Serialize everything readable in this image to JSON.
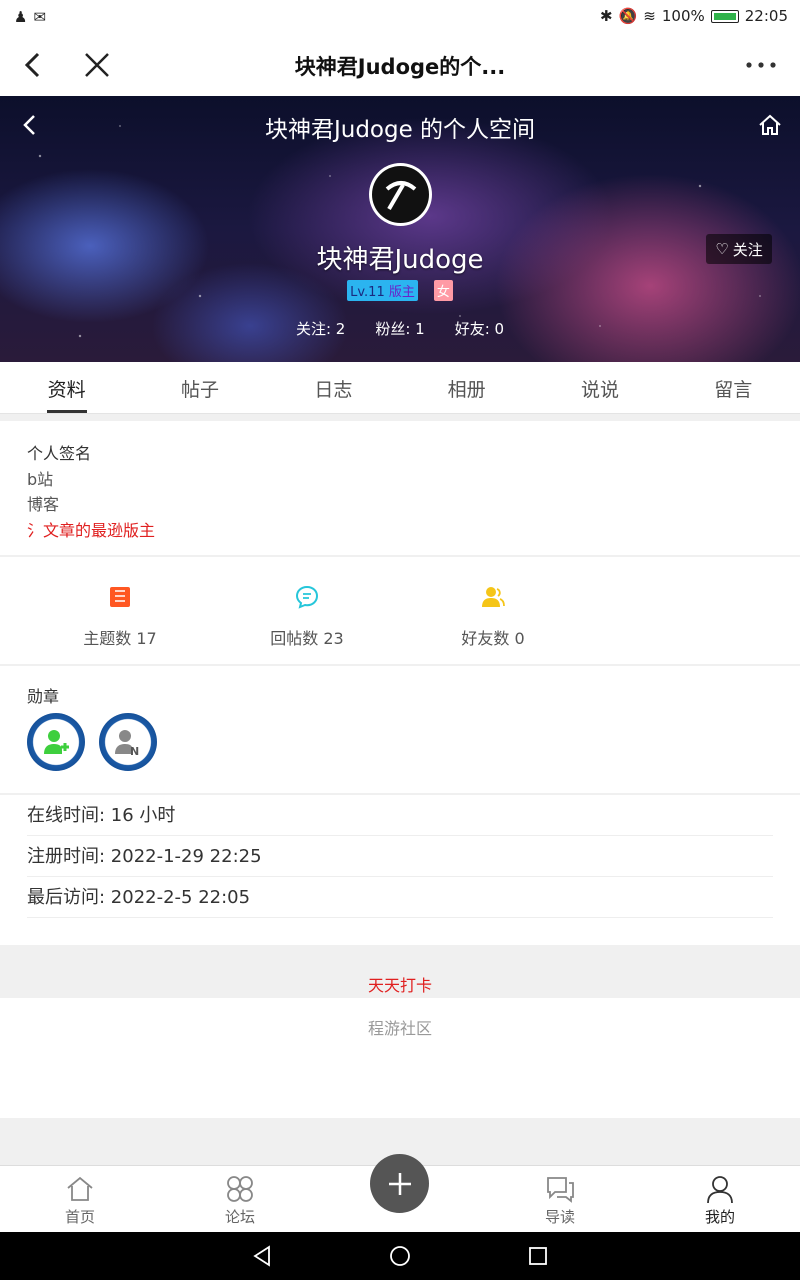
{
  "status_bar": {
    "battery": "100%",
    "time": "22:05"
  },
  "title_bar": {
    "title": "块神君Judoge的个..."
  },
  "hero": {
    "title": "块神君Judoge 的个人空间",
    "username": "块神君Judoge",
    "level": "Lv.11",
    "role": "版主",
    "gender": "女",
    "follow_label": "关注",
    "following": "关注: 2",
    "fans": "粉丝: 1",
    "friends": "好友: 0"
  },
  "tabs": [
    {
      "label": "资料",
      "active": true
    },
    {
      "label": "帖子"
    },
    {
      "label": "日志"
    },
    {
      "label": "相册"
    },
    {
      "label": "说说"
    },
    {
      "label": "留言"
    }
  ],
  "profile": {
    "signature_label": "个人签名",
    "lines": [
      "b站",
      "博客"
    ],
    "red_line": "氵文章的最逊版主"
  },
  "stats": [
    {
      "label": "主题数 17",
      "icon": "topics-icon",
      "color": "#ff5722"
    },
    {
      "label": "回帖数 23",
      "icon": "reply-icon",
      "color": "#26c6da"
    },
    {
      "label": "好友数 0",
      "icon": "friends-icon",
      "color": "#f5c518"
    }
  ],
  "medals": {
    "label": "勋章"
  },
  "info": {
    "online": "在线时间: 16 小时",
    "registered": "注册时间: 2022-1-29 22:25",
    "last_visit": "最后访问: 2022-2-5 22:05"
  },
  "checkin": "天天打卡",
  "footer": "程游社区",
  "bottom_nav": [
    {
      "label": "首页"
    },
    {
      "label": "论坛"
    },
    {
      "label": "导读"
    },
    {
      "label": "我的",
      "active": true
    }
  ]
}
